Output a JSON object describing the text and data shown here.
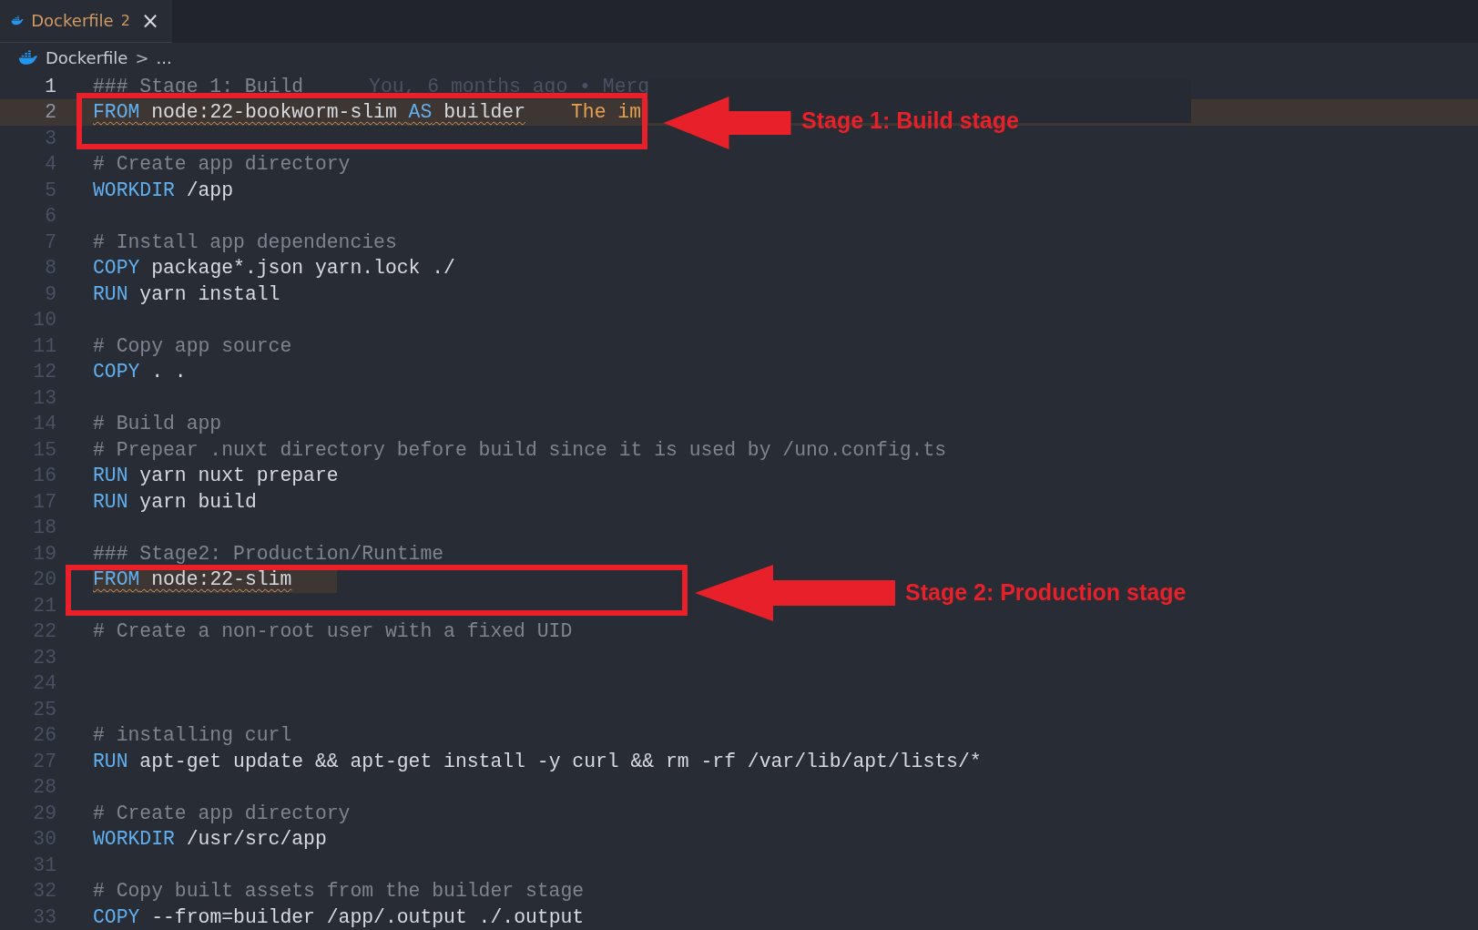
{
  "tabs": [
    {
      "label": "Dockerfile",
      "badge": "2",
      "close": "×",
      "selected": true
    }
  ],
  "breadcrumb": {
    "file": "Dockerfile",
    "separator": ">",
    "rest": "..."
  },
  "lines": [
    {
      "number": "1",
      "current": true,
      "tokens": [
        {
          "kind": "comment",
          "text": "### Stage 1: Build"
        }
      ],
      "blame": "You, 6 months ago • Merg"
    },
    {
      "number": "2",
      "line_highlight": true,
      "warning": true,
      "tokens": [
        {
          "kind": "keyword",
          "text": "FROM"
        },
        {
          "kind": "plain",
          "text": " node:22-bookworm-slim "
        },
        {
          "kind": "keyword",
          "text": "AS"
        },
        {
          "kind": "plain",
          "text": " builder"
        }
      ],
      "hint": "The im"
    },
    {
      "number": "3"
    },
    {
      "number": "4",
      "tokens": [
        {
          "kind": "comment",
          "text": "# Create app directory"
        }
      ]
    },
    {
      "number": "5",
      "tokens": [
        {
          "kind": "keyword",
          "text": "WORKDIR"
        },
        {
          "kind": "plain",
          "text": " /app"
        }
      ]
    },
    {
      "number": "6"
    },
    {
      "number": "7",
      "tokens": [
        {
          "kind": "comment",
          "text": "# Install app dependencies"
        }
      ]
    },
    {
      "number": "8",
      "tokens": [
        {
          "kind": "keyword",
          "text": "COPY"
        },
        {
          "kind": "plain",
          "text": " package*.json yarn.lock ./"
        }
      ]
    },
    {
      "number": "9",
      "tokens": [
        {
          "kind": "keyword",
          "text": "RUN"
        },
        {
          "kind": "plain",
          "text": " yarn install"
        }
      ]
    },
    {
      "number": "10"
    },
    {
      "number": "11",
      "tokens": [
        {
          "kind": "comment",
          "text": "# Copy app source"
        }
      ]
    },
    {
      "number": "12",
      "tokens": [
        {
          "kind": "keyword",
          "text": "COPY"
        },
        {
          "kind": "plain",
          "text": " . ."
        }
      ]
    },
    {
      "number": "13"
    },
    {
      "number": "14",
      "tokens": [
        {
          "kind": "comment",
          "text": "# Build app"
        }
      ]
    },
    {
      "number": "15",
      "tokens": [
        {
          "kind": "comment",
          "text": "# Prepear .nuxt directory before build since it is used by /uno.config.ts"
        }
      ]
    },
    {
      "number": "16",
      "tokens": [
        {
          "kind": "keyword",
          "text": "RUN"
        },
        {
          "kind": "plain",
          "text": " yarn nuxt prepare"
        }
      ]
    },
    {
      "number": "17",
      "tokens": [
        {
          "kind": "keyword",
          "text": "RUN"
        },
        {
          "kind": "plain",
          "text": " yarn build"
        }
      ]
    },
    {
      "number": "18"
    },
    {
      "number": "19",
      "tokens": [
        {
          "kind": "comment",
          "text": "### Stage2: Production/Runtime"
        }
      ]
    },
    {
      "number": "20",
      "range_highlight": true,
      "warning": true,
      "tokens": [
        {
          "kind": "keyword",
          "text": "FROM"
        },
        {
          "kind": "plain",
          "text": " node:22-slim"
        }
      ]
    },
    {
      "number": "21"
    },
    {
      "number": "22",
      "tokens": [
        {
          "kind": "comment",
          "text": "# Create a non-root user with a fixed UID"
        }
      ]
    },
    {
      "number": "23"
    },
    {
      "number": "24"
    },
    {
      "number": "25"
    },
    {
      "number": "26",
      "tokens": [
        {
          "kind": "comment",
          "text": "# installing curl"
        }
      ]
    },
    {
      "number": "27",
      "tokens": [
        {
          "kind": "keyword",
          "text": "RUN"
        },
        {
          "kind": "plain",
          "text": " apt-get update && apt-get install -y curl && rm -rf /var/lib/apt/lists/*"
        }
      ]
    },
    {
      "number": "28"
    },
    {
      "number": "29",
      "tokens": [
        {
          "kind": "comment",
          "text": "# Create app directory"
        }
      ]
    },
    {
      "number": "30",
      "tokens": [
        {
          "kind": "keyword",
          "text": "WORKDIR"
        },
        {
          "kind": "plain",
          "text": " /usr/src/app"
        }
      ]
    },
    {
      "number": "31"
    },
    {
      "number": "32",
      "tokens": [
        {
          "kind": "comment",
          "text": "# Copy built assets from the builder stage"
        }
      ]
    },
    {
      "number": "33",
      "tokens": [
        {
          "kind": "keyword",
          "text": "COPY"
        },
        {
          "kind": "plain",
          "text": " --from=builder /app/.output ./.output"
        }
      ]
    }
  ],
  "annotations": [
    {
      "label": "Stage 1: Build stage",
      "color": "#e8202a"
    },
    {
      "label": "Stage 2: Production stage",
      "color": "#e8202a"
    }
  ]
}
